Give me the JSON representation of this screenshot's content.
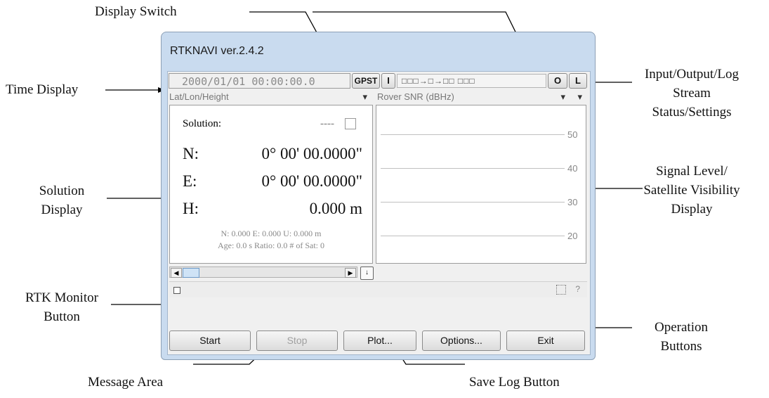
{
  "annotations": {
    "display_switch": "Display Switch",
    "time_display": "Time Display",
    "io_log": [
      "Input/Output/Log",
      "Stream",
      "Status/Settings"
    ],
    "solution_display": [
      "Solution",
      "Display"
    ],
    "signal_level": [
      "Signal Level/",
      "Satellite Visibility",
      "Display"
    ],
    "rtk_monitor": [
      "RTK Monitor",
      "Button"
    ],
    "operation_buttons": [
      "Operation",
      "Buttons"
    ],
    "message_area": "Message Area",
    "save_log": "Save Log Button"
  },
  "window": {
    "title": "RTKNAVI ver.2.4.2",
    "time": "2000/01/01 00:00:00.0",
    "time_system": "GPST",
    "input_button": "I",
    "stream_status": "□□□→□→□□ □□□",
    "output_button": "O",
    "log_button": "L",
    "left_selector": "Lat/Lon/Height",
    "right_selector": "Rover  SNR (dBHz)",
    "solution_label": "Solution:",
    "solution_status": "----",
    "n_label": "N:",
    "n_value": "0° 00' 00.0000\"",
    "e_label": "E:",
    "e_value": "0° 00' 00.0000\"",
    "h_label": "H:",
    "h_value": "0.000 m",
    "stats_line1": "N: 0.000 E: 0.000 U: 0.000 m",
    "stats_line2": "Age: 0.0 s Ratio: 0.0 # of Sat: 0",
    "snr_ticks": [
      "50",
      "40",
      "30",
      "20"
    ],
    "help_mark": "?",
    "buttons": {
      "start": "Start",
      "stop": "Stop",
      "plot": "Plot...",
      "options": "Options...",
      "exit": "Exit"
    }
  }
}
